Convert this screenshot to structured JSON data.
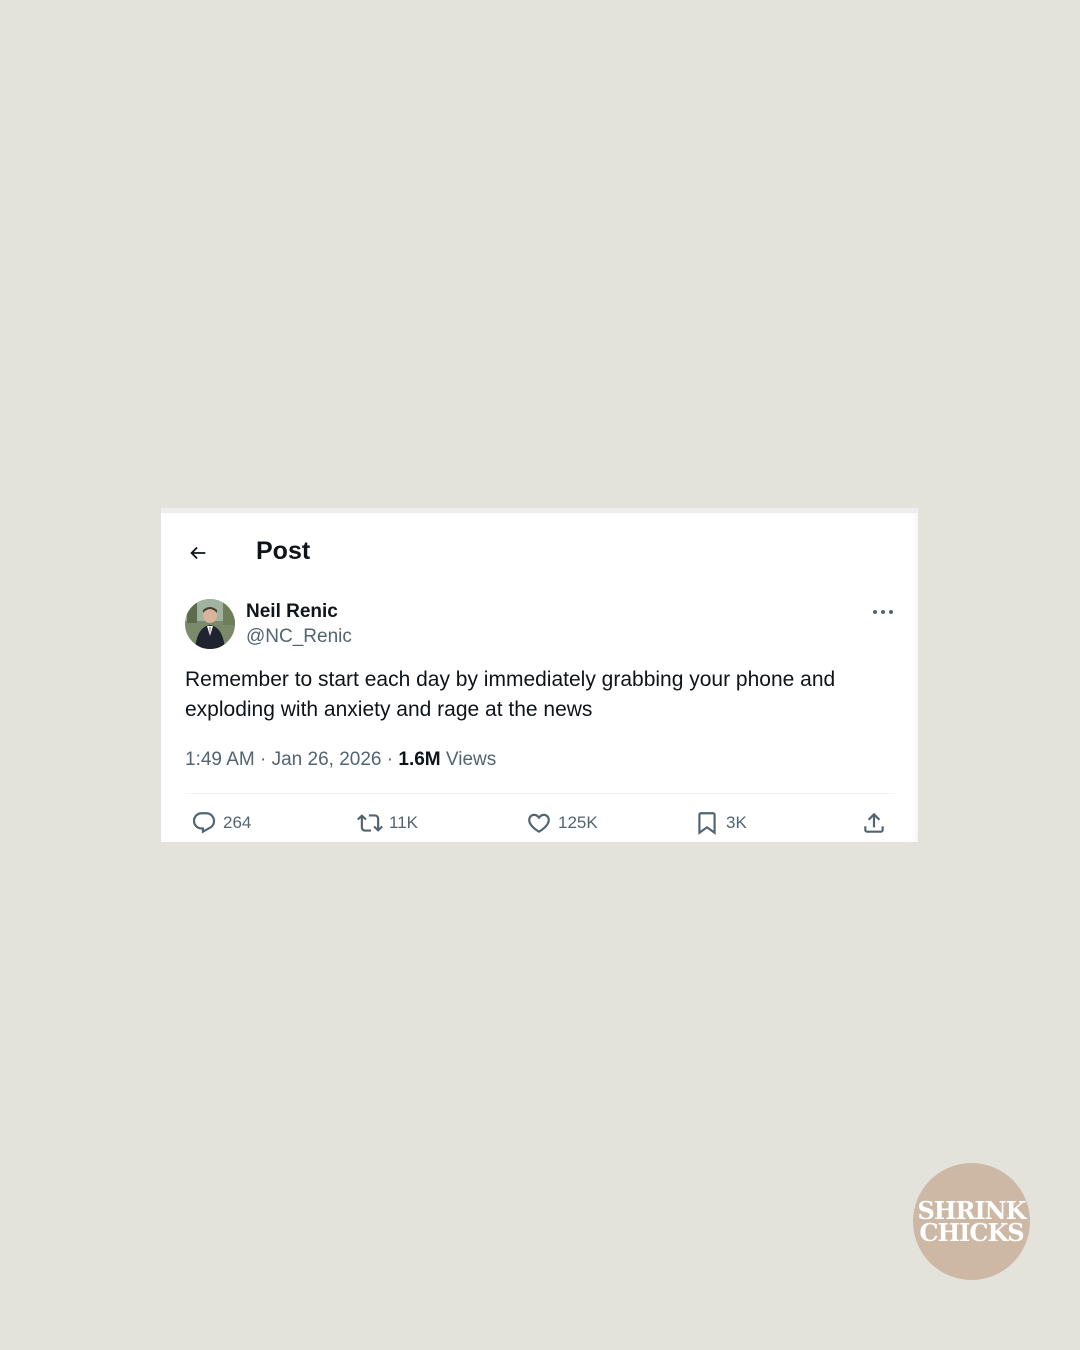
{
  "header": {
    "back_icon": "arrow-left-icon",
    "title": "Post"
  },
  "author": {
    "name": "Neil Renic",
    "handle": "@NC_Renic",
    "more_icon": "more-horizontal-icon"
  },
  "post": {
    "text": "Remember to start each day by immediately grabbing your phone and exploding with anxiety and rage at the news",
    "time": "1:49 AM",
    "separator": "·",
    "date": "Jan 26, 2026",
    "views_count": "1.6M",
    "views_label": "Views"
  },
  "actions": {
    "reply": {
      "icon": "reply-icon",
      "count": "264"
    },
    "repost": {
      "icon": "repost-icon",
      "count": "11K"
    },
    "like": {
      "icon": "heart-icon",
      "count": "125K"
    },
    "bookmark": {
      "icon": "bookmark-icon",
      "count": "3K"
    },
    "share": {
      "icon": "share-icon"
    }
  },
  "badge": {
    "line1": "SHRINK",
    "line2": "CHICKS"
  },
  "colors": {
    "background": "#e3e3db",
    "card": "#ffffff",
    "text_primary": "#0f1419",
    "text_secondary": "#536471",
    "badge": "#cdb8a6"
  }
}
